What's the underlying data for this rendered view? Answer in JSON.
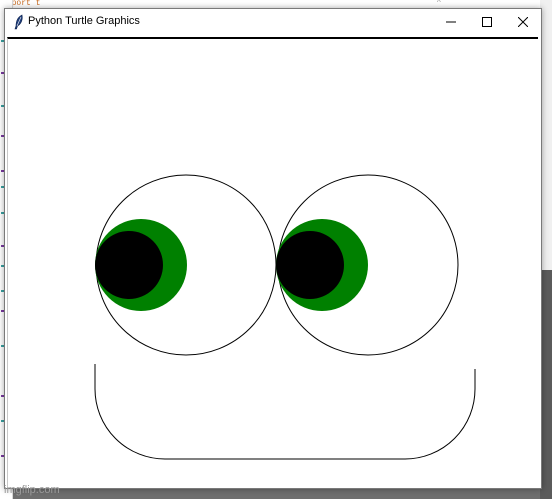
{
  "window": {
    "title": "Python Turtle Graphics",
    "icon": "feather-icon",
    "controls": [
      "minimize-icon",
      "maximize-icon",
      "close-icon"
    ]
  },
  "background": {
    "editor_fragment": "import t"
  },
  "watermark": "imgflip.com",
  "colors": {
    "iris": "#008000",
    "pupil": "#000000",
    "outline": "#000000",
    "canvas": "#ffffff"
  }
}
